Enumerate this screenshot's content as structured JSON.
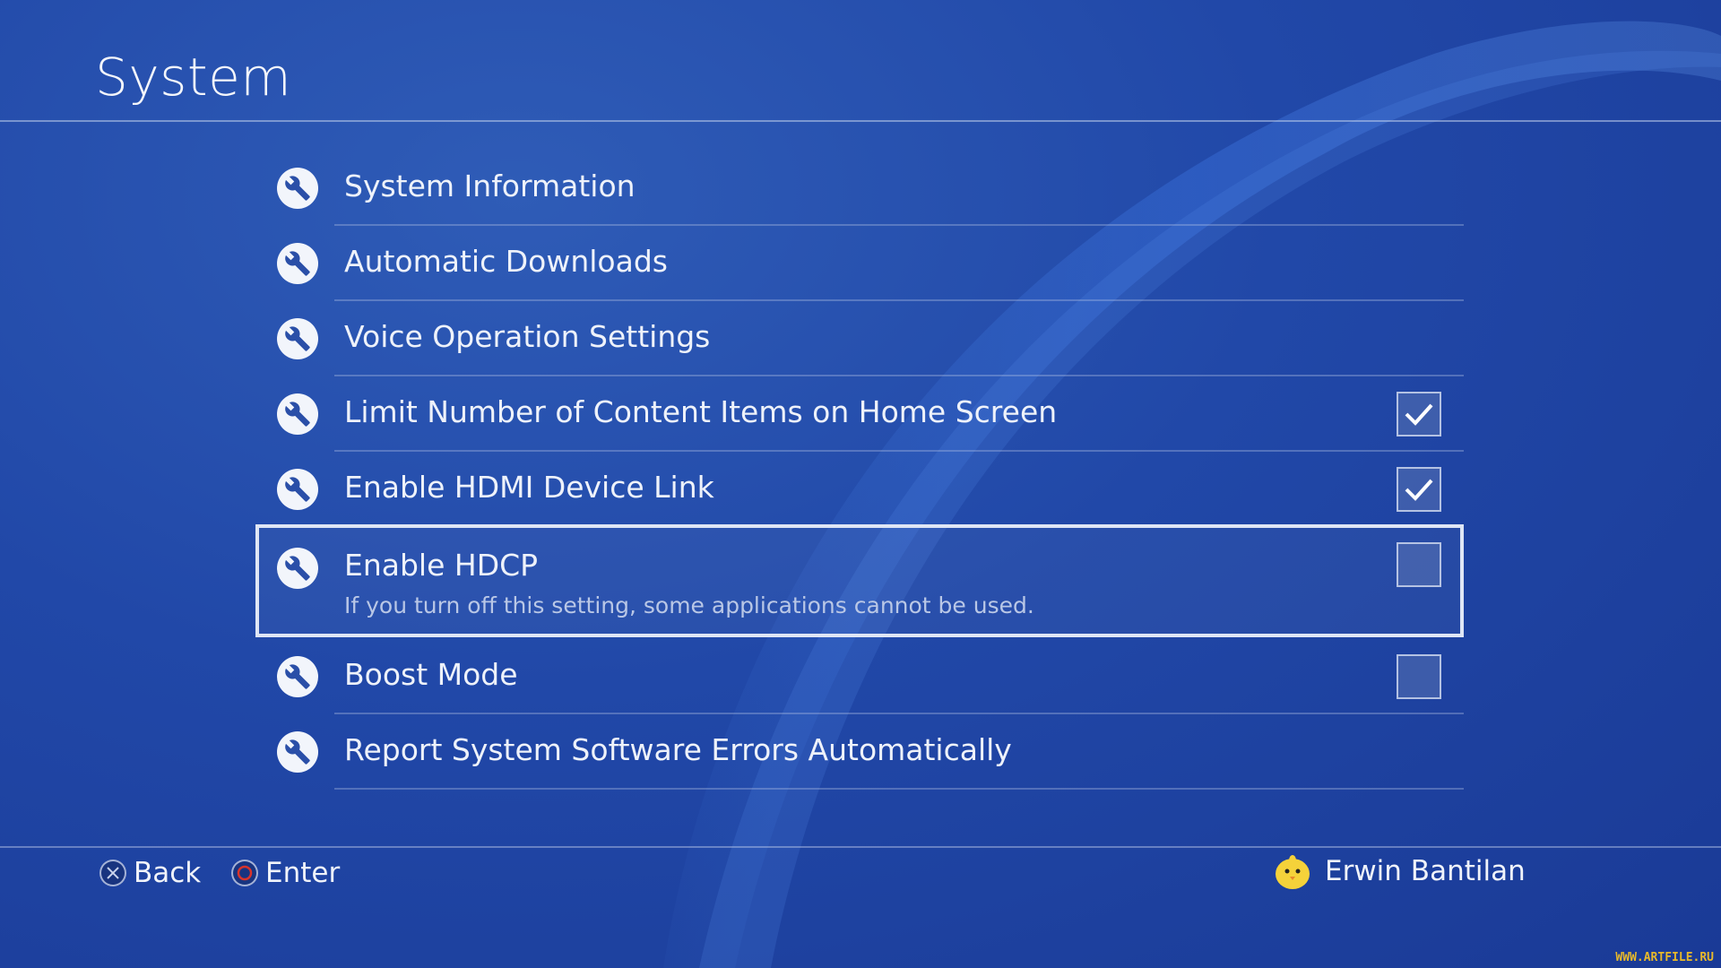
{
  "header": {
    "title": "System"
  },
  "menu": {
    "items": [
      {
        "label": "System Information",
        "icon": "wrench-icon",
        "has_checkbox": false
      },
      {
        "label": "Automatic Downloads",
        "icon": "wrench-icon",
        "has_checkbox": false
      },
      {
        "label": "Voice Operation Settings",
        "icon": "wrench-icon",
        "has_checkbox": false
      },
      {
        "label": "Limit Number of Content Items on Home Screen",
        "icon": "wrench-icon",
        "has_checkbox": true,
        "checked": true
      },
      {
        "label": "Enable HDMI Device Link",
        "icon": "wrench-icon",
        "has_checkbox": true,
        "checked": true
      },
      {
        "label": "Enable HDCP",
        "icon": "wrench-icon",
        "has_checkbox": true,
        "checked": false,
        "selected": true,
        "description": "If you turn off this setting, some applications cannot be used."
      },
      {
        "label": "Boost Mode",
        "icon": "wrench-icon",
        "has_checkbox": true,
        "checked": false
      },
      {
        "label": "Report System Software Errors Automatically",
        "icon": "wrench-icon",
        "has_checkbox": false
      }
    ]
  },
  "footer": {
    "back_label": "Back",
    "back_icon": "cross-button-icon",
    "enter_label": "Enter",
    "enter_icon": "circle-button-icon",
    "user_name": "Erwin Bantilan",
    "avatar_icon": "chick-avatar-icon"
  },
  "watermark": "WWW.ARTFILE.RU",
  "colors": {
    "background": "#2148a8",
    "text": "#eef2fa",
    "selection_border": "#dfe6f5",
    "circle_button": "#d9342b"
  }
}
